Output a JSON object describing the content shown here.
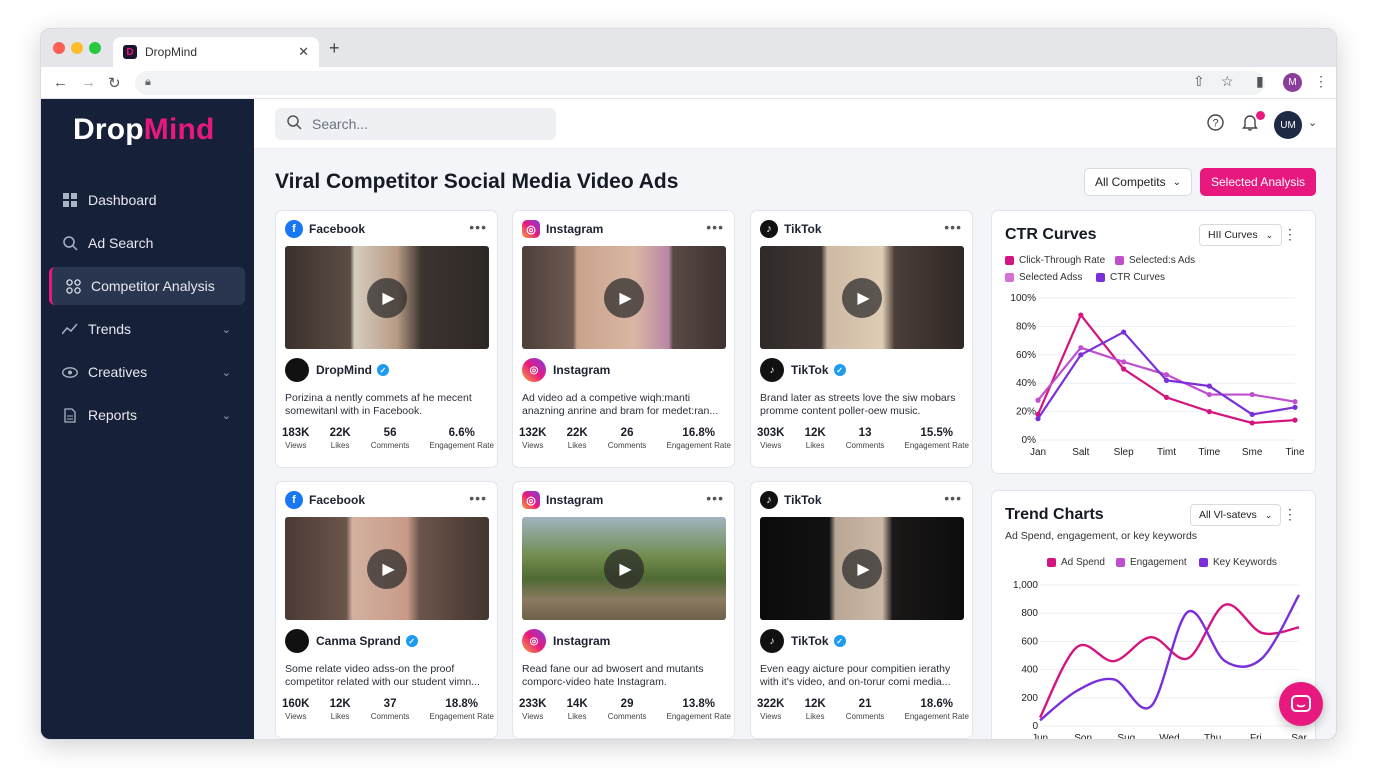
{
  "browser": {
    "tab_title": "DropMind",
    "tab_favicon": "D",
    "close": "✕",
    "new_tab": "+",
    "profile_initial": "M"
  },
  "sidebar": {
    "logo_a": "Drop",
    "logo_b": "Mind",
    "items": [
      {
        "label": "Dashboard",
        "icon": "grid-icon"
      },
      {
        "label": "Ad Search",
        "icon": "search-icon"
      },
      {
        "label": "Competitor Analysis",
        "icon": "nodes-icon",
        "active": true
      },
      {
        "label": "Trends",
        "icon": "trend-icon",
        "expandable": true
      },
      {
        "label": "Creatives",
        "icon": "eye-icon",
        "expandable": true
      },
      {
        "label": "Reports",
        "icon": "document-icon",
        "expandable": true
      }
    ]
  },
  "header": {
    "search_placeholder": "Search...",
    "avatar_initials": "UM",
    "notifications_badge": "1"
  },
  "page": {
    "title": "Viral Competitor Social Media Video Ads",
    "filter_label": "All Competits",
    "primary_button": "Selected Analysis"
  },
  "ads": [
    {
      "platform": "Facebook",
      "account": "DropMind",
      "desc": "Porizina a nently commets af he mecent somewitanl with in Facebook.",
      "stats": [
        {
          "v": "183K",
          "l": "Views"
        },
        {
          "v": "22K",
          "l": "Likes"
        },
        {
          "v": "56",
          "l": "Comments"
        },
        {
          "v": "6.6%",
          "l": "Engagement Rate"
        }
      ]
    },
    {
      "platform": "Instagram",
      "account": "Instagram",
      "desc": "Ad video ad a competive wiqh:manti anazning anrine and bram for medet:ran...",
      "stats": [
        {
          "v": "132K",
          "l": "Views"
        },
        {
          "v": "22K",
          "l": "Likes"
        },
        {
          "v": "26",
          "l": "Comments"
        },
        {
          "v": "16.8%",
          "l": "Engagement Rate"
        }
      ]
    },
    {
      "platform": "TikTok",
      "account": "TikTok",
      "desc": "Brand later as streets love the siw mobars promme content poller-oew music.",
      "stats": [
        {
          "v": "303K",
          "l": "Views"
        },
        {
          "v": "12K",
          "l": "Likes"
        },
        {
          "v": "13",
          "l": "Comments"
        },
        {
          "v": "15.5%",
          "l": "Engagement Rate"
        }
      ]
    },
    {
      "platform": "Facebook",
      "account": "Canma Sprand",
      "desc": "Some relate video adss-on the proof competitor  related with our student vimn...",
      "stats": [
        {
          "v": "160K",
          "l": "Views"
        },
        {
          "v": "12K",
          "l": "Likes"
        },
        {
          "v": "37",
          "l": "Comments"
        },
        {
          "v": "18.8%",
          "l": "Engagement Rate"
        }
      ]
    },
    {
      "platform": "Instagram",
      "account": "Instagram",
      "desc": "Read fane our ad bwosert and mutants comporc-video hate Instagram.",
      "stats": [
        {
          "v": "233K",
          "l": "Views"
        },
        {
          "v": "14K",
          "l": "Likes"
        },
        {
          "v": "29",
          "l": "Comments"
        },
        {
          "v": "13.8%",
          "l": "Engagement Rate"
        }
      ]
    },
    {
      "platform": "TikTok",
      "account": "TikTok",
      "desc": "Even eagy aicture pour compitien ierathy with it's video, and on-torur comi media...",
      "stats": [
        {
          "v": "322K",
          "l": "Views"
        },
        {
          "v": "12K",
          "l": "Likes"
        },
        {
          "v": "21",
          "l": "Comments"
        },
        {
          "v": "18.6%",
          "l": "Engagement Rate"
        }
      ]
    }
  ],
  "ctr_panel": {
    "title": "CTR Curves",
    "dropdown": "HII Curves",
    "legend": [
      "Click-Through Rate",
      "Selected:s Ads",
      "Selected Adss",
      "CTR Curves"
    ]
  },
  "trend_panel": {
    "title": "Trend Charts",
    "dropdown": "All Vl-satevs",
    "subtitle": "Ad Spend, engagement, or key keywords",
    "legend": [
      "Ad Spend",
      "Engagement",
      "Key Keywords"
    ]
  },
  "colors": {
    "accent": "#e8197e",
    "sidebar_bg": "#162038",
    "series_pink": "#d4157f",
    "series_orchid": "#c04fd0",
    "series_purple": "#7a2fd8"
  },
  "chart_data": [
    {
      "type": "line",
      "title": "CTR Curves",
      "categories": [
        "Jan",
        "Salt",
        "Slep",
        "Timt",
        "Time",
        "Sme",
        "Tine"
      ],
      "yticks": [
        "0%",
        "20%",
        "40%",
        "60%",
        "80%",
        "100%"
      ],
      "ylim": [
        0,
        100
      ],
      "legend_position": "top-left",
      "series": [
        {
          "name": "Click-Through Rate",
          "color": "#d4157f",
          "values": [
            18,
            88,
            50,
            30,
            20,
            12,
            14
          ]
        },
        {
          "name": "Selected:s Ads",
          "color": "#c04fd0",
          "values": [
            28,
            65,
            55,
            46,
            32,
            32,
            27
          ]
        },
        {
          "name": "CTR Curves",
          "color": "#7a2fd8",
          "values": [
            15,
            60,
            76,
            42,
            38,
            18,
            23
          ]
        }
      ]
    },
    {
      "type": "line",
      "title": "Trend Charts",
      "categories": [
        "Jun",
        "Son",
        "Sug",
        "Wed",
        "Thu",
        "Fri",
        "Sar"
      ],
      "yticks": [
        "0",
        "200",
        "400",
        "600",
        "800",
        "1,000"
      ],
      "ylim": [
        0,
        1000
      ],
      "legend_position": "top",
      "series": [
        {
          "name": "Ad Spend",
          "color": "#d4157f",
          "values": [
            60,
            560,
            460,
            630,
            480,
            860,
            660,
            700
          ]
        },
        {
          "name": "Key Keywords",
          "color": "#7a2fd8",
          "values": [
            40,
            250,
            330,
            140,
            810,
            460,
            480,
            930
          ]
        }
      ]
    }
  ]
}
